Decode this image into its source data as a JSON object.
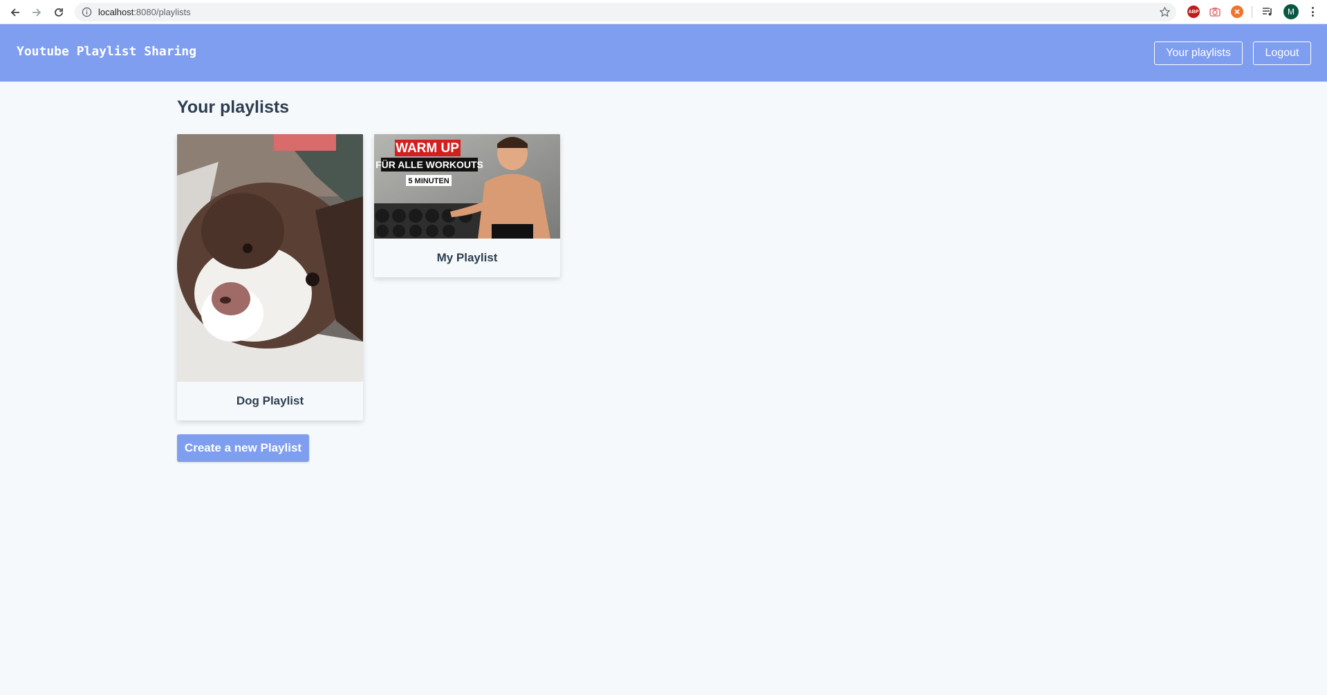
{
  "browser": {
    "url_host": "localhost",
    "url_path": ":8080/playlists",
    "profile_initial": "M",
    "ext_abp_label": "ABP"
  },
  "header": {
    "brand": "Youtube Playlist Sharing",
    "your_playlists_label": "Your playlists",
    "logout_label": "Logout"
  },
  "main": {
    "title": "Your playlists",
    "playlists": [
      {
        "name": "Dog Playlist"
      },
      {
        "name": "My Playlist",
        "thumbnail_text": {
          "line1": "WARM UP",
          "line2": "FÜR ALLE WORKOUTS",
          "line3": "5 MINUTEN"
        }
      }
    ],
    "create_label": "Create a new Playlist"
  },
  "colors": {
    "accent": "#7f9ef0",
    "page_bg": "#f6f9fb",
    "text": "#2c3e50"
  }
}
